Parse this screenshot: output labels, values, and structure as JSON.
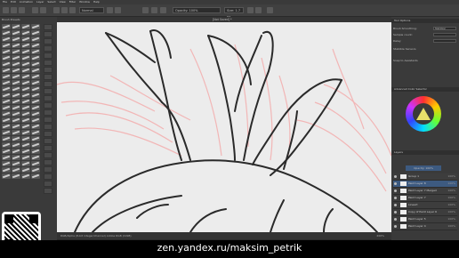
{
  "menubar": {
    "items": [
      "File",
      "Edit",
      "Animation",
      "Layer",
      "Select",
      "View",
      "Filter",
      "Window",
      "Help"
    ]
  },
  "toolbar": {
    "blend_mode": "Normal",
    "opacity": "Opacity: 100%",
    "size": "Size: 1.7 px"
  },
  "left_dock": {
    "title": "Brush Presets"
  },
  "canvas": {
    "tab_title": "[Not Saved] *"
  },
  "statusbar": {
    "text": "RGB/Alpha (8-bit integer/channel)  Adobe RGB (1998)",
    "zoom": "200%"
  },
  "right_dock": {
    "tool_options": "Tool Options",
    "brush_smoothing": "Brush Smoothing:",
    "smoothing_mode": "Stabilizer",
    "sample_count": "Sample count:",
    "delay": "Delay",
    "stabilize_sensors": "Stabilize Sensors",
    "snap_assistants": "Snap to Assistants",
    "color_selector": "Advanced Color Selector",
    "layers_title": "Layers",
    "opacity": "Opacity: 100%",
    "layers": [
      {
        "name": "Group 1",
        "pct": "100%"
      },
      {
        "name": "Paint Layer 8",
        "pct": "100%"
      },
      {
        "name": "Paint Layer 7 Merged",
        "pct": "100%"
      },
      {
        "name": "Paint Layer 7",
        "pct": "100%"
      },
      {
        "name": "Lineart",
        "pct": "100%"
      },
      {
        "name": "Copy of Paint Layer 6",
        "pct": "100%"
      },
      {
        "name": "Paint Layer 5",
        "pct": "100%"
      },
      {
        "name": "Paint Layer 4",
        "pct": "100%"
      }
    ]
  },
  "watermark": "zen.yandex.ru/maksim_petrik",
  "colors": {
    "sketch": "#f2b6b6",
    "line": "#2a2a2a",
    "selected_layer": "#3d5a80"
  }
}
